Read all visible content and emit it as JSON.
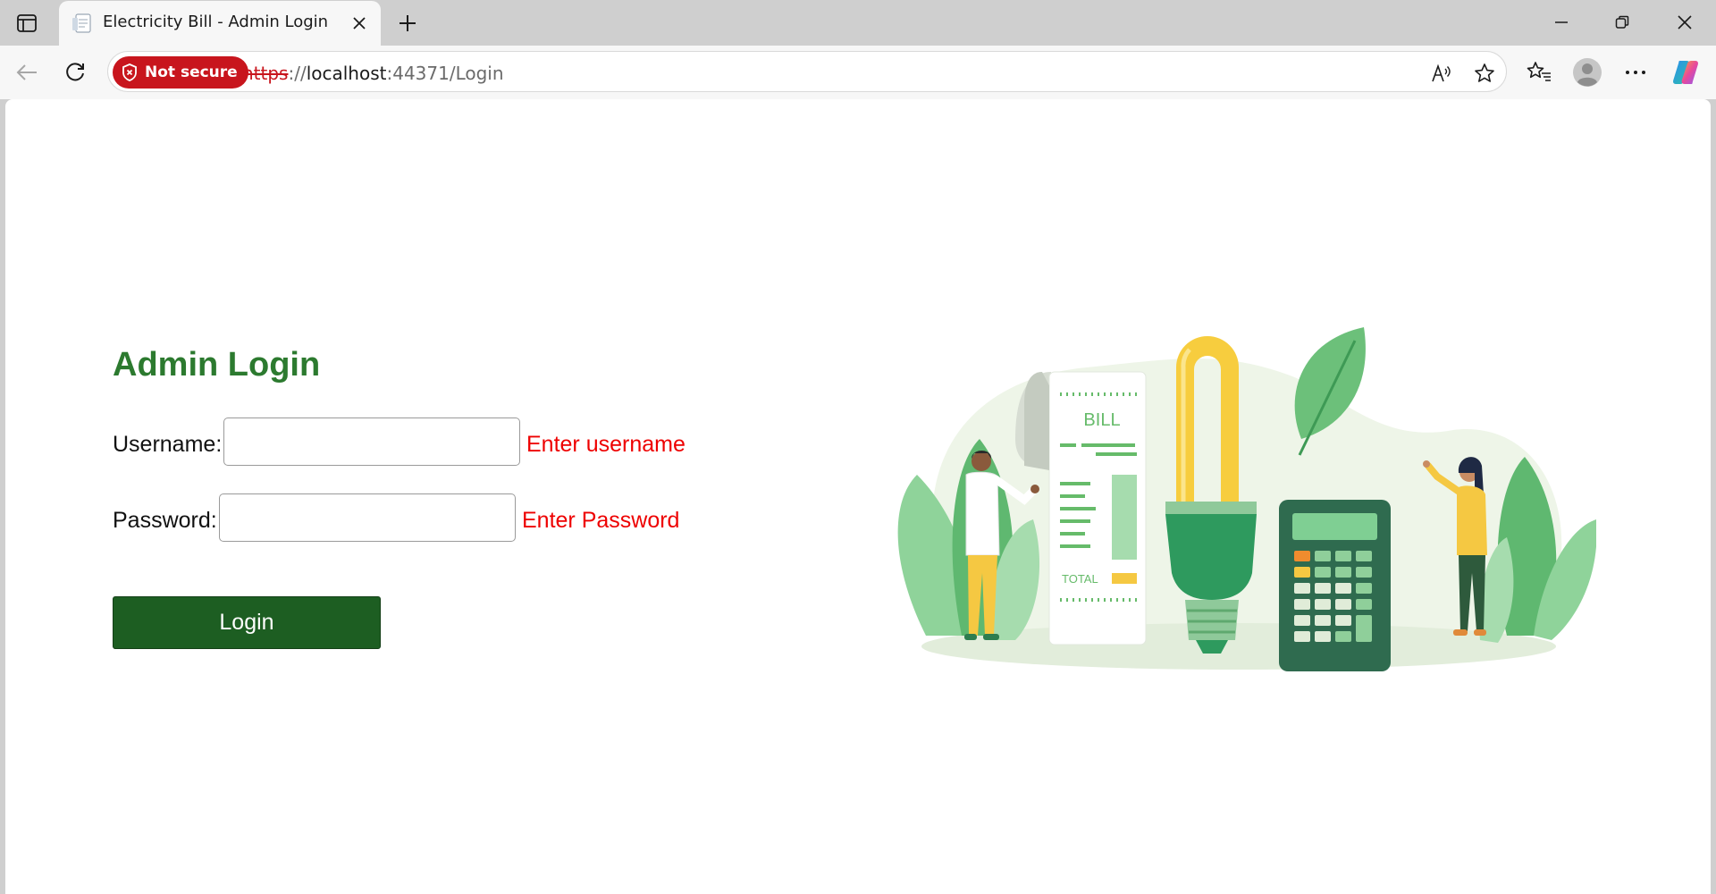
{
  "browser": {
    "tab_title": "Electricity Bill - Admin Login",
    "security_label": "Not secure",
    "url_scheme": "https",
    "url_sep": "://",
    "url_host": "localhost",
    "url_rest": ":44371/Login"
  },
  "login": {
    "title": "Admin Login",
    "username_label": "Username:",
    "username_value": "",
    "username_error": "Enter username",
    "password_label": "Password:",
    "password_value": "",
    "password_error": "Enter Password",
    "submit_label": "Login"
  },
  "illustration": {
    "bill_heading": "BILL",
    "bill_total": "TOTAL"
  },
  "colors": {
    "title_green": "#2c7a2f",
    "button_green": "#1d5e22",
    "error_red": "#ee0000",
    "not_secure_red": "#c8151d"
  },
  "icons": [
    "tab-actions-icon",
    "document-favicon-icon",
    "close-icon",
    "plus-icon",
    "minimize-icon",
    "restore-icon",
    "window-close-icon",
    "back-arrow-icon",
    "refresh-icon",
    "shield-icon",
    "read-aloud-icon",
    "star-icon",
    "favorites-icon",
    "profile-icon",
    "more-icon",
    "copilot-icon"
  ]
}
